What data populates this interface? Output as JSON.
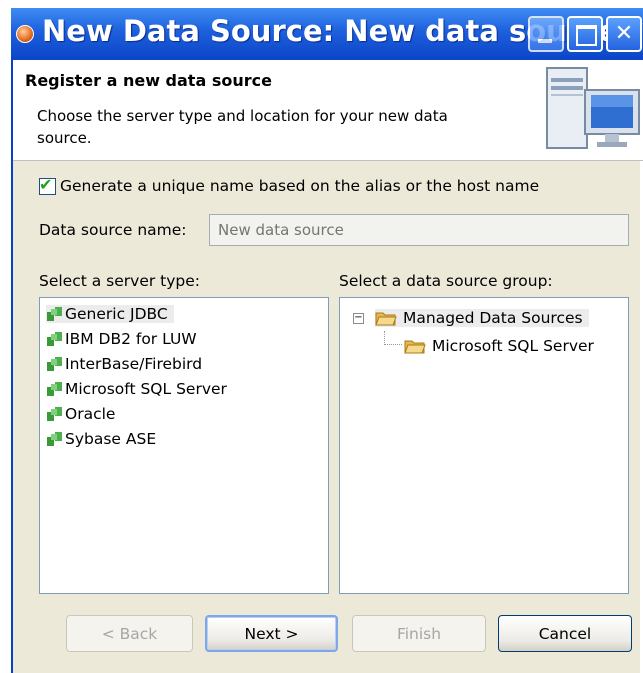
{
  "window": {
    "title": "New Data Source: New data source"
  },
  "banner": {
    "title": "Register a new data source",
    "description": "Choose the server type and location for your new data source."
  },
  "options": {
    "generate_name_label": "Generate a unique name based on the alias or the host name",
    "generate_name_checked": true,
    "datasource_name_label": "Data source name:",
    "datasource_name_placeholder": "New data source"
  },
  "server_types": {
    "label": "Select a server type:",
    "items": [
      "Generic JDBC",
      "IBM DB2 for LUW",
      "InterBase/Firebird",
      "Microsoft SQL Server",
      "Oracle",
      "Sybase ASE"
    ],
    "selected": "Generic JDBC"
  },
  "groups": {
    "label": "Select a data source group:",
    "root": "Managed Data Sources",
    "child": "Microsoft SQL Server"
  },
  "buttons": {
    "back": "< Back",
    "next": "Next >",
    "finish": "Finish",
    "cancel": "Cancel"
  },
  "colors": {
    "titlebar": "#0b45c8",
    "dialog_bg": "#ece9d8",
    "checkbox_tick": "#21a121"
  }
}
